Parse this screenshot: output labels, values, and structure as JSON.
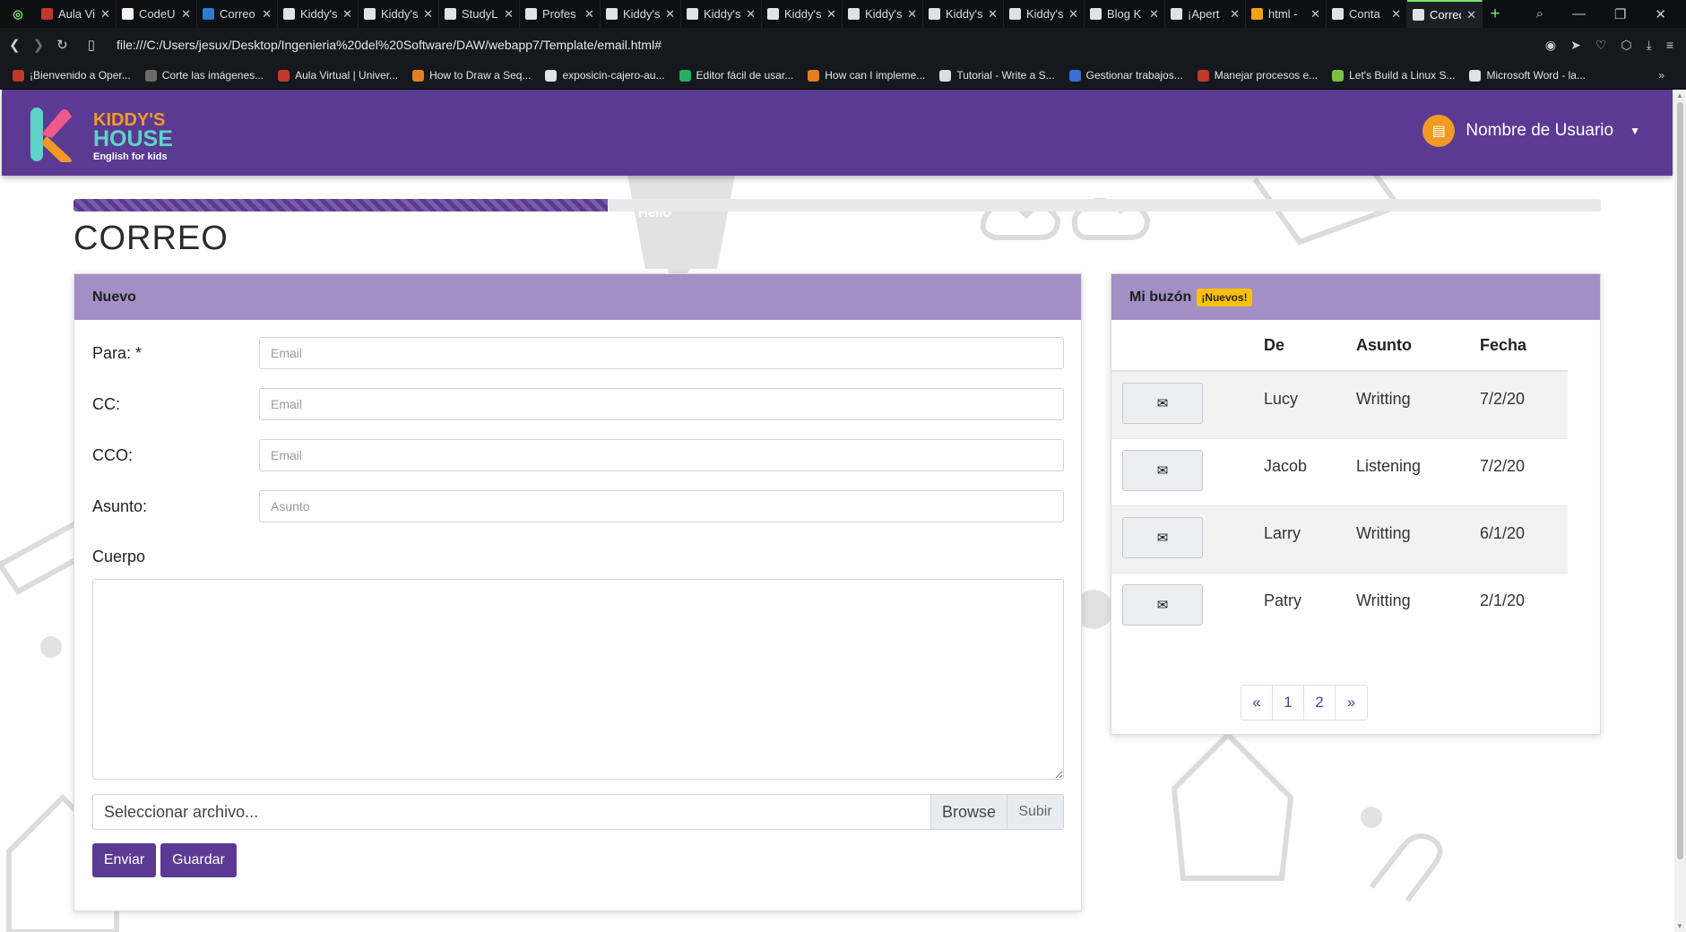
{
  "browser": {
    "tabs": [
      {
        "label": "Aula Vi",
        "icon": "aula-icon",
        "color": "#c0392b"
      },
      {
        "label": "CodeU",
        "icon": "github-icon",
        "color": "#f5f5f5"
      },
      {
        "label": "Correo",
        "icon": "outlook-icon",
        "color": "#2b7cd3"
      },
      {
        "label": "Kiddy's",
        "icon": "document-icon",
        "color": "#dfe3e8"
      },
      {
        "label": "Kiddy's",
        "icon": "document-icon",
        "color": "#dfe3e8"
      },
      {
        "label": "StudyL",
        "icon": "document-icon",
        "color": "#dfe3e8"
      },
      {
        "label": "Profes",
        "icon": "document-icon",
        "color": "#dfe3e8"
      },
      {
        "label": "Kiddy's",
        "icon": "document-icon",
        "color": "#dfe3e8"
      },
      {
        "label": "Kiddy's",
        "icon": "document-icon",
        "color": "#dfe3e8"
      },
      {
        "label": "Kiddy's",
        "icon": "document-icon",
        "color": "#dfe3e8"
      },
      {
        "label": "Kiddy's",
        "icon": "document-icon",
        "color": "#dfe3e8"
      },
      {
        "label": "Kiddy's",
        "icon": "document-icon",
        "color": "#dfe3e8"
      },
      {
        "label": "Kiddy's",
        "icon": "document-icon",
        "color": "#dfe3e8"
      },
      {
        "label": "Blog K",
        "icon": "document-icon",
        "color": "#dfe3e8"
      },
      {
        "label": "¡Apert",
        "icon": "document-icon",
        "color": "#dfe3e8"
      },
      {
        "label": "html -",
        "icon": "stackoverflow-icon",
        "color": "#f0a30a"
      },
      {
        "label": "Conta",
        "icon": "document-icon",
        "color": "#dfe3e8"
      }
    ],
    "active_tab": "Correo",
    "url": "file:///C:/Users/jesux/Desktop/Ingenieria%20del%20Software/DAW/webapp7/Template/email.html#",
    "bookmarks": [
      "¡Bienvenido a Oper...",
      "Corte las imágenes...",
      "Aula Virtual | Univer...",
      "How to Draw a Seq...",
      "exposicin-cajero-au...",
      "Editor fácil de usar...",
      "How can I impleme...",
      "Tutorial - Write a S...",
      "Gestionar trabajos...",
      "Manejar procesos e...",
      "Let's Build a Linux S...",
      "Microsoft Word - la..."
    ]
  },
  "brand": {
    "logo_top": "KIDDY'S",
    "logo_bottom": "HOUSE",
    "tagline": "English for kids",
    "primary_color": "#5b3a94",
    "header_tint": "#a28fc5",
    "accent_orange": "#f29b24",
    "accent_teal": "#5ed3c9"
  },
  "user": {
    "name": "Nombre de Usuario"
  },
  "progress_percent": 35,
  "page_title": "CORREO",
  "compose": {
    "header": "Nuevo",
    "fields": [
      {
        "label": "Para: *",
        "placeholder": "Email"
      },
      {
        "label": "CC:",
        "placeholder": "Email"
      },
      {
        "label": "CCO:",
        "placeholder": "Email"
      },
      {
        "label": "Asunto:",
        "placeholder": "Asunto"
      }
    ],
    "body_label": "Cuerpo",
    "file_placeholder": "Seleccionar archivo...",
    "browse_label": "Browse",
    "upload_label": "Subir",
    "send_label": "Enviar",
    "save_label": "Guardar"
  },
  "mailbox": {
    "title": "Mi buzón",
    "badge": "¡Nuevos!",
    "columns": [
      "",
      "De",
      "Asunto",
      "Fecha"
    ],
    "rows": [
      {
        "from": "Lucy",
        "subject": "Writting",
        "date": "7/2/20"
      },
      {
        "from": "Jacob",
        "subject": "Listening",
        "date": "7/2/20"
      },
      {
        "from": "Larry",
        "subject": "Writting",
        "date": "6/1/20"
      },
      {
        "from": "Patry",
        "subject": "Writting",
        "date": "2/1/20"
      }
    ],
    "pagination": [
      "«",
      "1",
      "2",
      "»"
    ]
  },
  "background_text": "Hello"
}
